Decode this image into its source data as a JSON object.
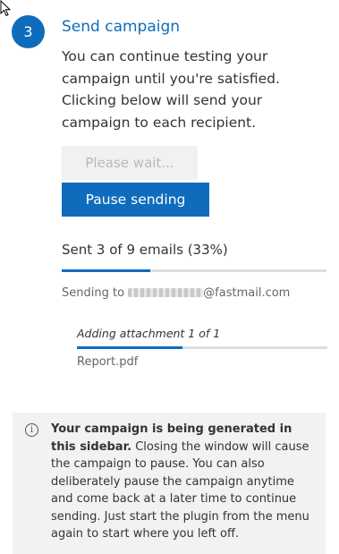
{
  "step": {
    "number": "3",
    "title": "Send campaign",
    "description": "You can continue testing your campaign until you're satisfied. Clicking below will send your campaign to each recipient."
  },
  "buttons": {
    "wait_label": "Please wait...",
    "pause_label": "Pause sending"
  },
  "progress": {
    "text": "Sent 3 of 9 emails (33%)",
    "fraction": 0.333
  },
  "sending": {
    "prefix": "Sending to ",
    "email_suffix": "@fastmail.com"
  },
  "attachment": {
    "label": "Adding attachment 1 of 1",
    "file": "Report.pdf",
    "fraction": 0.42
  },
  "info": {
    "bold": "Your campaign is being generated in this sidebar.",
    "text": " Closing the window will cause the campaign to pause. You can also deliberately pause the campaign anytime and come back at a later time to continue sending. Just start the plugin from the menu again to start where you left off."
  },
  "colors": {
    "accent": "#0f6cbd",
    "disabled_bg": "#f1f1f1",
    "info_bg": "#f3f2f1"
  },
  "icons": {
    "cursor": "mouse-pointer-icon",
    "info": "info-icon"
  }
}
